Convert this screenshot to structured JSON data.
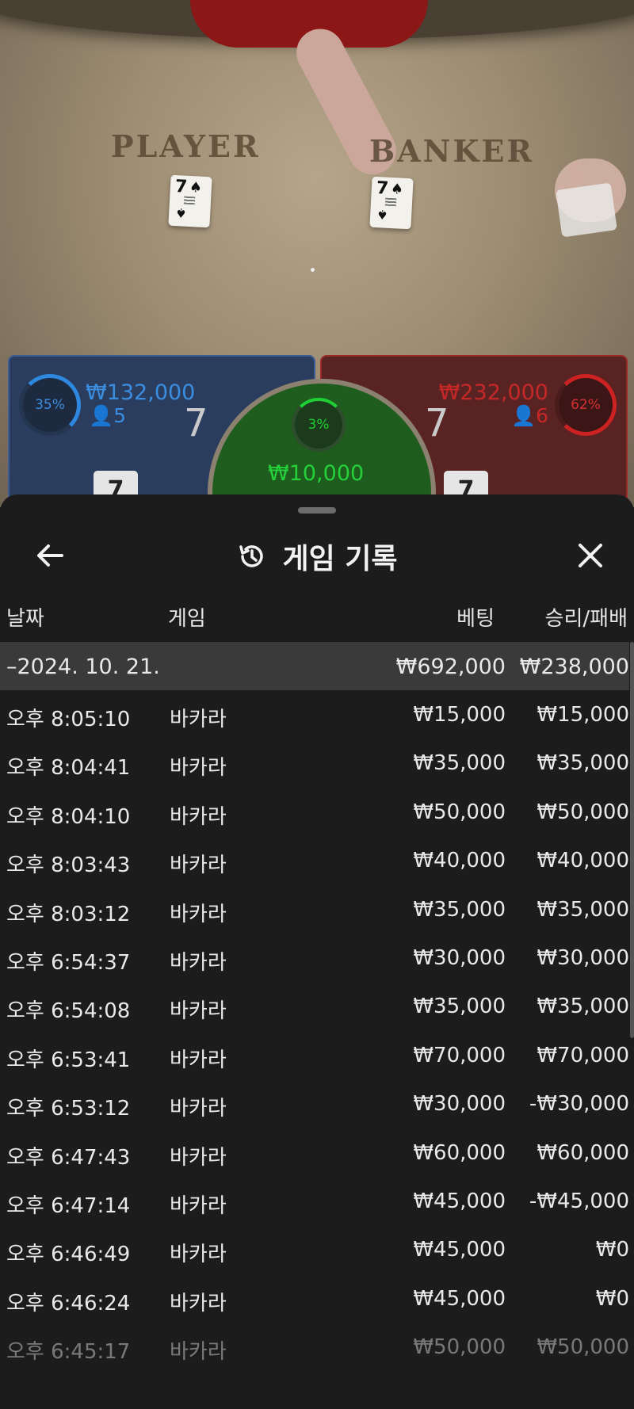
{
  "table": {
    "player_word": "PLAYER",
    "banker_word": "BANKER",
    "player_card_rank": "7",
    "banker_card_rank": "7",
    "player": {
      "percent": "35%",
      "amount": "₩132,000",
      "count": "5",
      "score": "7",
      "card": "7"
    },
    "banker": {
      "percent": "62%",
      "amount": "₩232,000",
      "count": "6",
      "score": "7",
      "card": "7"
    },
    "tie": {
      "percent": "3%",
      "amount": "₩10,000"
    },
    "colors": {
      "player": "#3b8de0",
      "banker": "#c62828",
      "tie": "#25d03a"
    }
  },
  "sheet": {
    "title": "게임 기록",
    "history_icon": "history-icon",
    "back_icon": "arrow-left-icon",
    "close_icon": "close-icon",
    "columns": {
      "date": "날짜",
      "game": "게임",
      "bet": "베팅",
      "win_loss": "승리/패배"
    },
    "day": {
      "label": "–2024. 10. 21.",
      "bet": "₩692,000",
      "win_loss": "₩238,000"
    },
    "rows": [
      {
        "time": "오후 8:05:10",
        "game": "바카라",
        "bet": "₩15,000",
        "win_loss": "₩15,000"
      },
      {
        "time": "오후 8:04:41",
        "game": "바카라",
        "bet": "₩35,000",
        "win_loss": "₩35,000"
      },
      {
        "time": "오후 8:04:10",
        "game": "바카라",
        "bet": "₩50,000",
        "win_loss": "₩50,000"
      },
      {
        "time": "오후 8:03:43",
        "game": "바카라",
        "bet": "₩40,000",
        "win_loss": "₩40,000"
      },
      {
        "time": "오후 8:03:12",
        "game": "바카라",
        "bet": "₩35,000",
        "win_loss": "₩35,000"
      },
      {
        "time": "오후 6:54:37",
        "game": "바카라",
        "bet": "₩30,000",
        "win_loss": "₩30,000"
      },
      {
        "time": "오후 6:54:08",
        "game": "바카라",
        "bet": "₩35,000",
        "win_loss": "₩35,000"
      },
      {
        "time": "오후 6:53:41",
        "game": "바카라",
        "bet": "₩70,000",
        "win_loss": "₩70,000"
      },
      {
        "time": "오후 6:53:12",
        "game": "바카라",
        "bet": "₩30,000",
        "win_loss": "-₩30,000"
      },
      {
        "time": "오후 6:47:43",
        "game": "바카라",
        "bet": "₩60,000",
        "win_loss": "₩60,000"
      },
      {
        "time": "오후 6:47:14",
        "game": "바카라",
        "bet": "₩45,000",
        "win_loss": "-₩45,000"
      },
      {
        "time": "오후 6:46:49",
        "game": "바카라",
        "bet": "₩45,000",
        "win_loss": "₩0"
      },
      {
        "time": "오후 6:46:24",
        "game": "바카라",
        "bet": "₩45,000",
        "win_loss": "₩0"
      },
      {
        "time": "오후 6:45:17",
        "game": "바카라",
        "bet": "₩50,000",
        "win_loss": "₩50,000"
      }
    ]
  }
}
